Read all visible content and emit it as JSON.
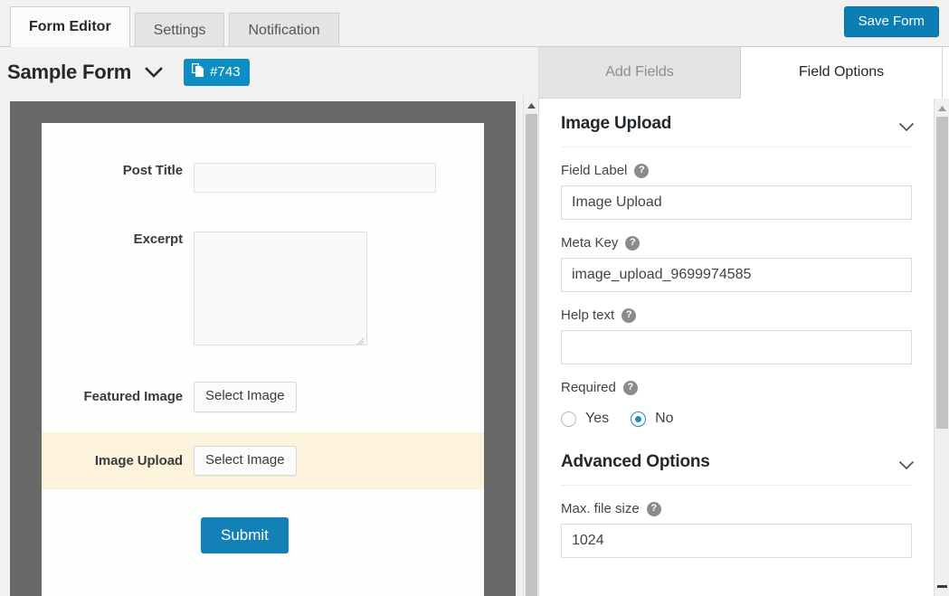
{
  "topbar": {
    "tabs": [
      {
        "label": "Form Editor",
        "active": true
      },
      {
        "label": "Settings",
        "active": false
      },
      {
        "label": "Notification",
        "active": false
      }
    ],
    "save_label": "Save Form"
  },
  "form_header": {
    "title": "Sample Form",
    "badge_label": "#743"
  },
  "preview": {
    "fields": [
      {
        "label": "Post Title",
        "control": "text"
      },
      {
        "label": "Excerpt",
        "control": "textarea"
      },
      {
        "label": "Featured Image",
        "control": "button",
        "button_label": "Select Image"
      },
      {
        "label": "Image Upload",
        "control": "button",
        "button_label": "Select Image",
        "highlighted": true
      }
    ],
    "submit_label": "Submit"
  },
  "right_panel": {
    "tabs": [
      {
        "label": "Add Fields",
        "active": false
      },
      {
        "label": "Field Options",
        "active": true
      }
    ],
    "section_title": "Image Upload",
    "fields": [
      {
        "label": "Field Label",
        "value": "Image Upload",
        "help": "?"
      },
      {
        "label": "Meta Key",
        "value": "image_upload_9699974585",
        "help": "?"
      },
      {
        "label": "Help text",
        "value": "",
        "help": "?"
      }
    ],
    "required": {
      "label": "Required",
      "help": "?",
      "options": [
        {
          "label": "Yes",
          "checked": false
        },
        {
          "label": "No",
          "checked": true
        }
      ]
    },
    "advanced": {
      "title": "Advanced Options",
      "fields": [
        {
          "label": "Max. file size",
          "value": "1024",
          "help": "?"
        }
      ]
    }
  },
  "colors": {
    "accent_blue": "#0b7fb5",
    "badge_blue": "#0d8ec4",
    "submit_blue": "#1480b8",
    "highlight_cream": "#fdf2dc",
    "panel_dark": "#686868",
    "radio_blue": "#1e8cbe"
  }
}
